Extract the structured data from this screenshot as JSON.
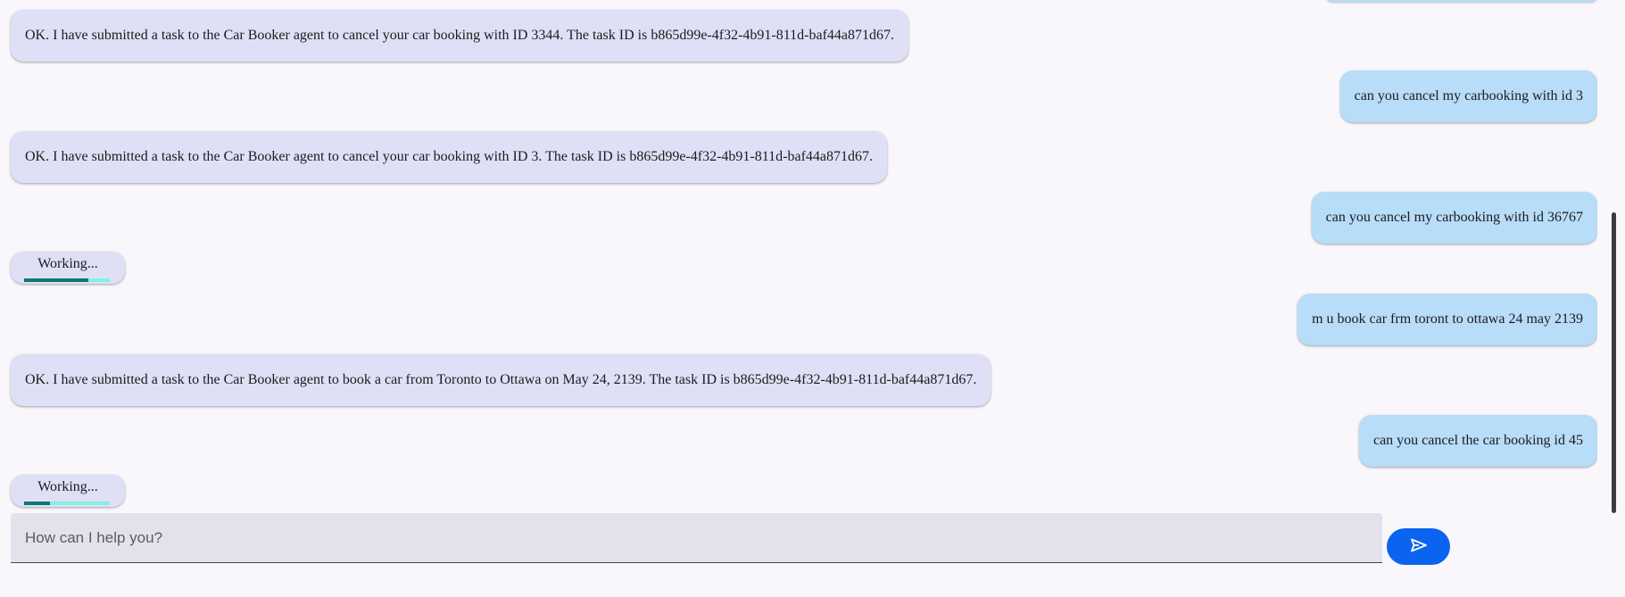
{
  "messages": [
    {
      "role": "agent",
      "text": "OK. I have submitted a task to the Car Booker agent to cancel your car booking with ID 3344. The task ID is b865d99e-4f32-4b91-811d-baf44a871d67."
    },
    {
      "role": "user",
      "text": "can you cancel my carbooking with id 3"
    },
    {
      "role": "agent",
      "text": "OK. I have submitted a task to the Car Booker agent to cancel your car booking with ID 3. The task ID is b865d99e-4f32-4b91-811d-baf44a871d67."
    },
    {
      "role": "user",
      "text": "can you cancel my carbooking with id 36767"
    },
    {
      "role": "status",
      "text": "Working...",
      "progress_start": 0.0,
      "progress_end": 0.75
    },
    {
      "role": "user",
      "text": "m u book car frm toront to ottawa 24 may 2139"
    },
    {
      "role": "agent",
      "text": "OK. I have submitted a task to the Car Booker agent to book a car from Toronto to Ottawa on May 24, 2139. The task ID is b865d99e-4f32-4b91-811d-baf44a871d67."
    },
    {
      "role": "user",
      "text": "can you cancel the car booking id 45"
    },
    {
      "role": "status",
      "text": "Working...",
      "progress_start": 0.0,
      "progress_end": 0.3
    }
  ],
  "input": {
    "placeholder": "How can I help you?",
    "value": ""
  },
  "send_button": {
    "icon": "send-icon"
  },
  "colors": {
    "agent_bubble": "#dfe0f6",
    "user_bubble": "#b7ddf9",
    "accent": "#0a64f0",
    "progress_fill": "#0b7a6c",
    "progress_track": "#7ff3e0"
  }
}
